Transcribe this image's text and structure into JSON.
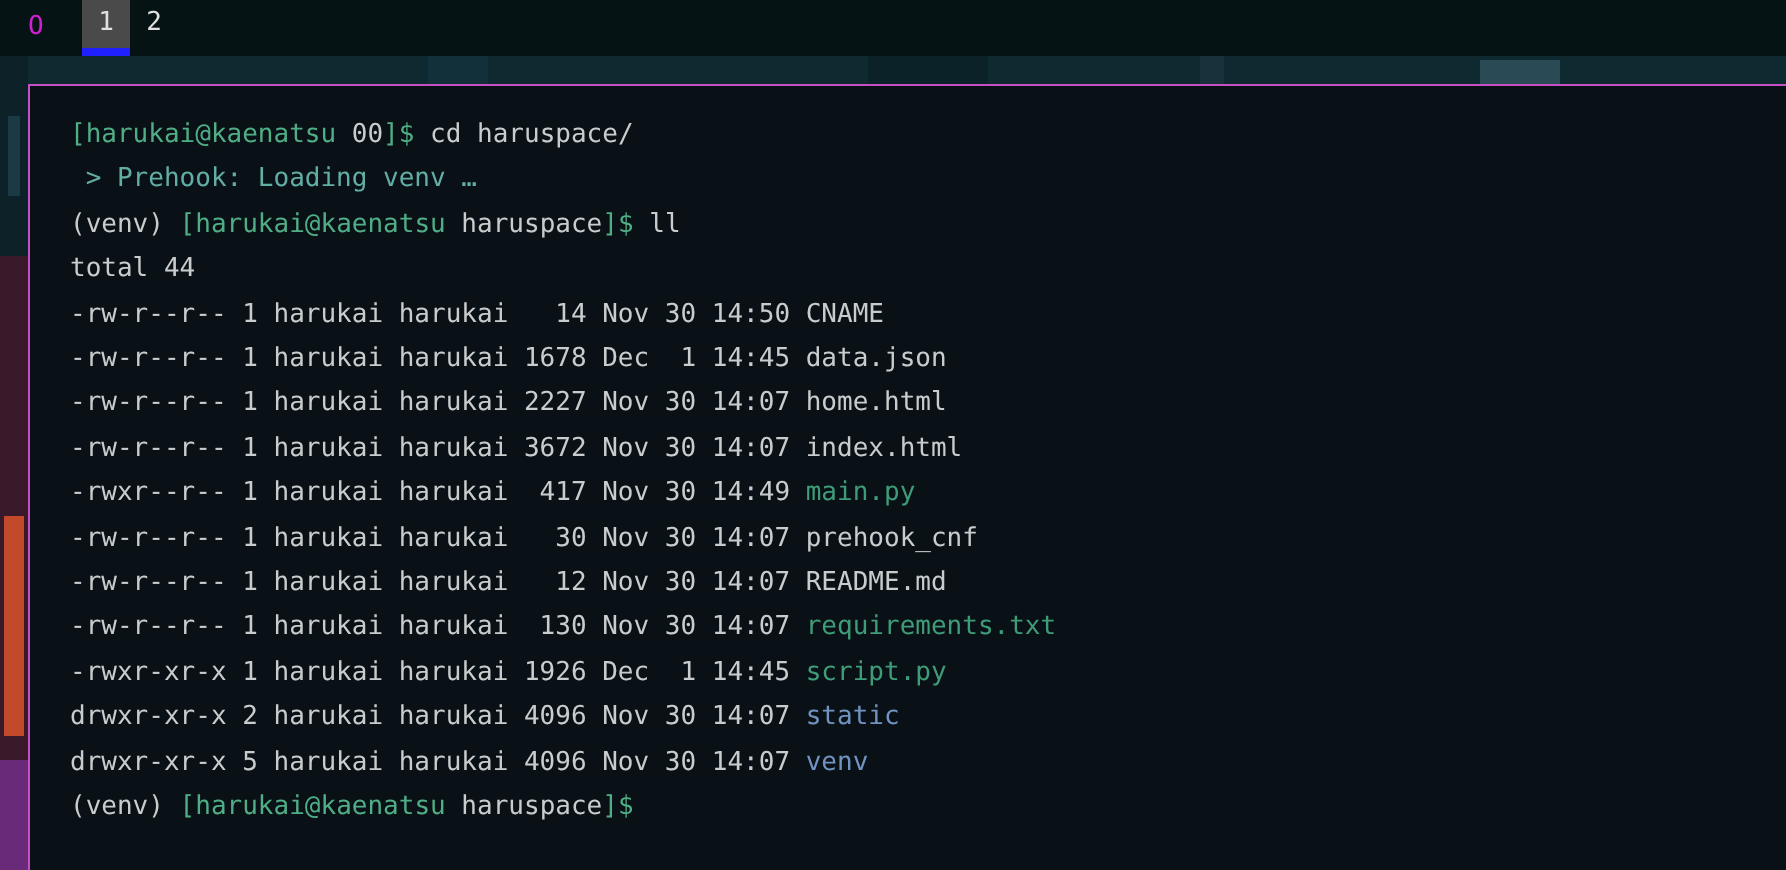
{
  "bar": {
    "indicator": "O",
    "workspaces": [
      {
        "label": "1",
        "selected": true
      },
      {
        "label": "2",
        "selected": false
      }
    ]
  },
  "terminal": {
    "lines": [
      {
        "segments": [
          {
            "kind": "prompt",
            "text": "[harukai@kaenatsu"
          },
          {
            "kind": "plain",
            "text": " 00"
          },
          {
            "kind": "prompt",
            "text": "]$"
          },
          {
            "kind": "plain",
            "text": " cd haruspace/"
          }
        ]
      },
      {
        "segments": [
          {
            "kind": "hook",
            "text": " > Prehook: Loading venv …"
          }
        ]
      },
      {
        "segments": [
          {
            "kind": "plain",
            "text": "(venv) "
          },
          {
            "kind": "prompt",
            "text": "[harukai@kaenatsu"
          },
          {
            "kind": "plain",
            "text": " haruspace"
          },
          {
            "kind": "prompt",
            "text": "]$"
          },
          {
            "kind": "plain",
            "text": " ll"
          }
        ]
      },
      {
        "segments": [
          {
            "kind": "plain",
            "text": "total 44"
          }
        ]
      },
      {
        "segments": [
          {
            "kind": "plain",
            "text": "-rw-r--r-- 1 harukai harukai   14 Nov 30 14:50 "
          },
          {
            "kind": "plain",
            "text": "CNAME"
          }
        ]
      },
      {
        "segments": [
          {
            "kind": "plain",
            "text": "-rw-r--r-- 1 harukai harukai 1678 Dec  1 14:45 "
          },
          {
            "kind": "plain",
            "text": "data.json"
          }
        ]
      },
      {
        "segments": [
          {
            "kind": "plain",
            "text": "-rw-r--r-- 1 harukai harukai 2227 Nov 30 14:07 "
          },
          {
            "kind": "plain",
            "text": "home.html"
          }
        ]
      },
      {
        "segments": [
          {
            "kind": "plain",
            "text": "-rw-r--r-- 1 harukai harukai 3672 Nov 30 14:07 "
          },
          {
            "kind": "plain",
            "text": "index.html"
          }
        ]
      },
      {
        "segments": [
          {
            "kind": "plain",
            "text": "-rwxr--r-- 1 harukai harukai  417 Nov 30 14:49 "
          },
          {
            "kind": "exec",
            "text": "main.py"
          }
        ]
      },
      {
        "segments": [
          {
            "kind": "plain",
            "text": "-rw-r--r-- 1 harukai harukai   30 Nov 30 14:07 "
          },
          {
            "kind": "plain",
            "text": "prehook_cnf"
          }
        ]
      },
      {
        "segments": [
          {
            "kind": "plain",
            "text": "-rw-r--r-- 1 harukai harukai   12 Nov 30 14:07 "
          },
          {
            "kind": "plain",
            "text": "README.md"
          }
        ]
      },
      {
        "segments": [
          {
            "kind": "plain",
            "text": "-rw-r--r-- 1 harukai harukai  130 Nov 30 14:07 "
          },
          {
            "kind": "exec",
            "text": "requirements.txt"
          }
        ]
      },
      {
        "segments": [
          {
            "kind": "plain",
            "text": "-rwxr-xr-x 1 harukai harukai 1926 Dec  1 14:45 "
          },
          {
            "kind": "exec",
            "text": "script.py"
          }
        ]
      },
      {
        "segments": [
          {
            "kind": "plain",
            "text": "drwxr-xr-x 2 harukai harukai 4096 Nov 30 14:07 "
          },
          {
            "kind": "dir",
            "text": "static"
          }
        ]
      },
      {
        "segments": [
          {
            "kind": "plain",
            "text": "drwxr-xr-x 5 harukai harukai 4096 Nov 30 14:07 "
          },
          {
            "kind": "dir",
            "text": "venv"
          }
        ]
      },
      {
        "segments": [
          {
            "kind": "plain",
            "text": "(venv) "
          },
          {
            "kind": "prompt",
            "text": "[harukai@kaenatsu"
          },
          {
            "kind": "plain",
            "text": " haruspace"
          },
          {
            "kind": "prompt",
            "text": "]$"
          }
        ]
      }
    ]
  }
}
